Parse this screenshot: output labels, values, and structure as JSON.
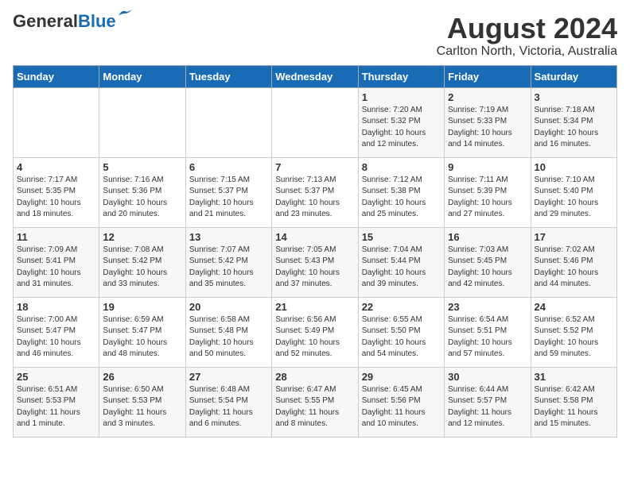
{
  "header": {
    "logo_line1": "General",
    "logo_line2": "Blue",
    "title": "August 2024",
    "subtitle": "Carlton North, Victoria, Australia"
  },
  "days_of_week": [
    "Sunday",
    "Monday",
    "Tuesday",
    "Wednesday",
    "Thursday",
    "Friday",
    "Saturday"
  ],
  "weeks": [
    [
      {
        "day": "",
        "info": ""
      },
      {
        "day": "",
        "info": ""
      },
      {
        "day": "",
        "info": ""
      },
      {
        "day": "",
        "info": ""
      },
      {
        "day": "1",
        "info": "Sunrise: 7:20 AM\nSunset: 5:32 PM\nDaylight: 10 hours\nand 12 minutes."
      },
      {
        "day": "2",
        "info": "Sunrise: 7:19 AM\nSunset: 5:33 PM\nDaylight: 10 hours\nand 14 minutes."
      },
      {
        "day": "3",
        "info": "Sunrise: 7:18 AM\nSunset: 5:34 PM\nDaylight: 10 hours\nand 16 minutes."
      }
    ],
    [
      {
        "day": "4",
        "info": "Sunrise: 7:17 AM\nSunset: 5:35 PM\nDaylight: 10 hours\nand 18 minutes."
      },
      {
        "day": "5",
        "info": "Sunrise: 7:16 AM\nSunset: 5:36 PM\nDaylight: 10 hours\nand 20 minutes."
      },
      {
        "day": "6",
        "info": "Sunrise: 7:15 AM\nSunset: 5:37 PM\nDaylight: 10 hours\nand 21 minutes."
      },
      {
        "day": "7",
        "info": "Sunrise: 7:13 AM\nSunset: 5:37 PM\nDaylight: 10 hours\nand 23 minutes."
      },
      {
        "day": "8",
        "info": "Sunrise: 7:12 AM\nSunset: 5:38 PM\nDaylight: 10 hours\nand 25 minutes."
      },
      {
        "day": "9",
        "info": "Sunrise: 7:11 AM\nSunset: 5:39 PM\nDaylight: 10 hours\nand 27 minutes."
      },
      {
        "day": "10",
        "info": "Sunrise: 7:10 AM\nSunset: 5:40 PM\nDaylight: 10 hours\nand 29 minutes."
      }
    ],
    [
      {
        "day": "11",
        "info": "Sunrise: 7:09 AM\nSunset: 5:41 PM\nDaylight: 10 hours\nand 31 minutes."
      },
      {
        "day": "12",
        "info": "Sunrise: 7:08 AM\nSunset: 5:42 PM\nDaylight: 10 hours\nand 33 minutes."
      },
      {
        "day": "13",
        "info": "Sunrise: 7:07 AM\nSunset: 5:42 PM\nDaylight: 10 hours\nand 35 minutes."
      },
      {
        "day": "14",
        "info": "Sunrise: 7:05 AM\nSunset: 5:43 PM\nDaylight: 10 hours\nand 37 minutes."
      },
      {
        "day": "15",
        "info": "Sunrise: 7:04 AM\nSunset: 5:44 PM\nDaylight: 10 hours\nand 39 minutes."
      },
      {
        "day": "16",
        "info": "Sunrise: 7:03 AM\nSunset: 5:45 PM\nDaylight: 10 hours\nand 42 minutes."
      },
      {
        "day": "17",
        "info": "Sunrise: 7:02 AM\nSunset: 5:46 PM\nDaylight: 10 hours\nand 44 minutes."
      }
    ],
    [
      {
        "day": "18",
        "info": "Sunrise: 7:00 AM\nSunset: 5:47 PM\nDaylight: 10 hours\nand 46 minutes."
      },
      {
        "day": "19",
        "info": "Sunrise: 6:59 AM\nSunset: 5:47 PM\nDaylight: 10 hours\nand 48 minutes."
      },
      {
        "day": "20",
        "info": "Sunrise: 6:58 AM\nSunset: 5:48 PM\nDaylight: 10 hours\nand 50 minutes."
      },
      {
        "day": "21",
        "info": "Sunrise: 6:56 AM\nSunset: 5:49 PM\nDaylight: 10 hours\nand 52 minutes."
      },
      {
        "day": "22",
        "info": "Sunrise: 6:55 AM\nSunset: 5:50 PM\nDaylight: 10 hours\nand 54 minutes."
      },
      {
        "day": "23",
        "info": "Sunrise: 6:54 AM\nSunset: 5:51 PM\nDaylight: 10 hours\nand 57 minutes."
      },
      {
        "day": "24",
        "info": "Sunrise: 6:52 AM\nSunset: 5:52 PM\nDaylight: 10 hours\nand 59 minutes."
      }
    ],
    [
      {
        "day": "25",
        "info": "Sunrise: 6:51 AM\nSunset: 5:53 PM\nDaylight: 11 hours\nand 1 minute."
      },
      {
        "day": "26",
        "info": "Sunrise: 6:50 AM\nSunset: 5:53 PM\nDaylight: 11 hours\nand 3 minutes."
      },
      {
        "day": "27",
        "info": "Sunrise: 6:48 AM\nSunset: 5:54 PM\nDaylight: 11 hours\nand 6 minutes."
      },
      {
        "day": "28",
        "info": "Sunrise: 6:47 AM\nSunset: 5:55 PM\nDaylight: 11 hours\nand 8 minutes."
      },
      {
        "day": "29",
        "info": "Sunrise: 6:45 AM\nSunset: 5:56 PM\nDaylight: 11 hours\nand 10 minutes."
      },
      {
        "day": "30",
        "info": "Sunrise: 6:44 AM\nSunset: 5:57 PM\nDaylight: 11 hours\nand 12 minutes."
      },
      {
        "day": "31",
        "info": "Sunrise: 6:42 AM\nSunset: 5:58 PM\nDaylight: 11 hours\nand 15 minutes."
      }
    ]
  ]
}
